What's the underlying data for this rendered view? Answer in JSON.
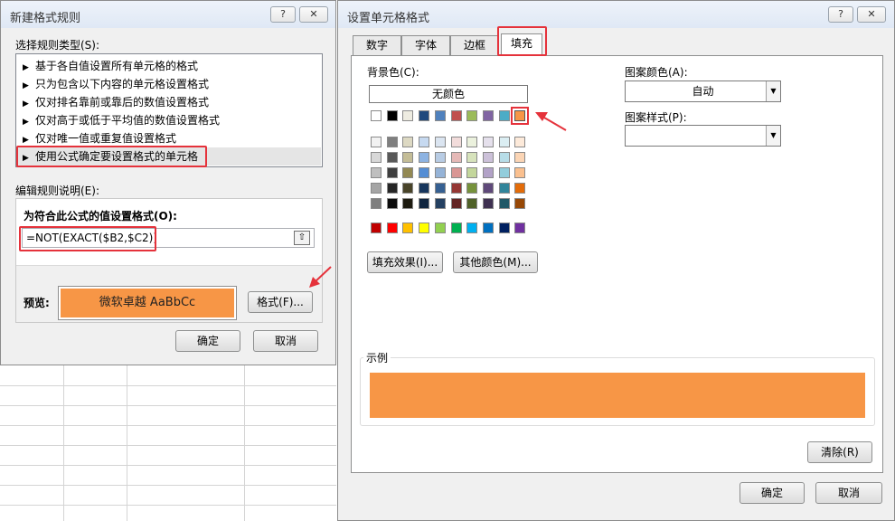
{
  "left_dialog": {
    "title": "新建格式规则",
    "help_btn": "?",
    "close_btn": "✕",
    "rule_type_label": "选择规则类型(S):",
    "rules": [
      "基于各自值设置所有单元格的格式",
      "只为包含以下内容的单元格设置格式",
      "仅对排名靠前或靠后的数值设置格式",
      "仅对高于或低于平均值的数值设置格式",
      "仅对唯一值或重复值设置格式",
      "使用公式确定要设置格式的单元格"
    ],
    "selected_rule_index": 5,
    "edit_desc_label": "编辑规则说明(E):",
    "formula_label": "为符合此公式的值设置格式(O):",
    "formula_value": "=NOT(EXACT($B2,$C2))",
    "preview_label": "预览:",
    "preview_text": "微软卓越  AaBbCc",
    "format_button": "格式(F)...",
    "ok_button": "确定",
    "cancel_button": "取消"
  },
  "right_dialog": {
    "title": "设置单元格格式",
    "help_btn": "?",
    "close_btn": "✕",
    "tabs": [
      "数字",
      "字体",
      "边框",
      "填充"
    ],
    "active_tab": "填充",
    "bg_color_label": "背景色(C):",
    "no_color_button": "无颜色",
    "fill_effects_button": "填充效果(I)...",
    "more_colors_button": "其他颜色(M)...",
    "pattern_color_label": "图案颜色(A):",
    "pattern_color_value": "自动",
    "pattern_style_label": "图案样式(P):",
    "pattern_style_value": "",
    "sample_label": "示例",
    "sample_color": "#F79646",
    "clear_button": "清除(R)",
    "ok_button": "确定",
    "cancel_button": "取消",
    "palette": {
      "theme_row": [
        "#FFFFFF",
        "#000000",
        "#EEECE1",
        "#1F497D",
        "#4F81BD",
        "#C0504D",
        "#9BBB59",
        "#8064A2",
        "#4BACC6",
        "#F79646"
      ],
      "tint_rows": [
        [
          "#F2F2F2",
          "#7F7F7F",
          "#DDD9C3",
          "#C6D9F0",
          "#DBE5F1",
          "#F2DCDB",
          "#EBF1DD",
          "#E5E0EC",
          "#DBEEF3",
          "#FDEADA"
        ],
        [
          "#D8D8D8",
          "#595959",
          "#C4BD97",
          "#8DB3E2",
          "#B8CCE4",
          "#E5B9B7",
          "#D7E3BC",
          "#CCC1D9",
          "#B7DDE8",
          "#FBD5B5"
        ],
        [
          "#BFBFBF",
          "#3F3F3F",
          "#938953",
          "#548DD4",
          "#95B3D7",
          "#D99694",
          "#C3D69B",
          "#B2A2C7",
          "#92CDDC",
          "#FAC08F"
        ],
        [
          "#A5A5A5",
          "#262626",
          "#494429",
          "#17365D",
          "#366092",
          "#953734",
          "#76923C",
          "#5F497A",
          "#31859B",
          "#E36C09"
        ],
        [
          "#7F7F7F",
          "#0C0C0C",
          "#1D1B10",
          "#0F243E",
          "#244061",
          "#632423",
          "#4F6128",
          "#3F3151",
          "#205867",
          "#974806"
        ]
      ],
      "standard_row": [
        "#C00000",
        "#FF0000",
        "#FFC000",
        "#FFFF00",
        "#92D050",
        "#00B050",
        "#00B0F0",
        "#0070C0",
        "#002060",
        "#7030A0"
      ],
      "selected": "#F79646"
    }
  },
  "annotations": {
    "highlight_color": "#E5323B"
  }
}
